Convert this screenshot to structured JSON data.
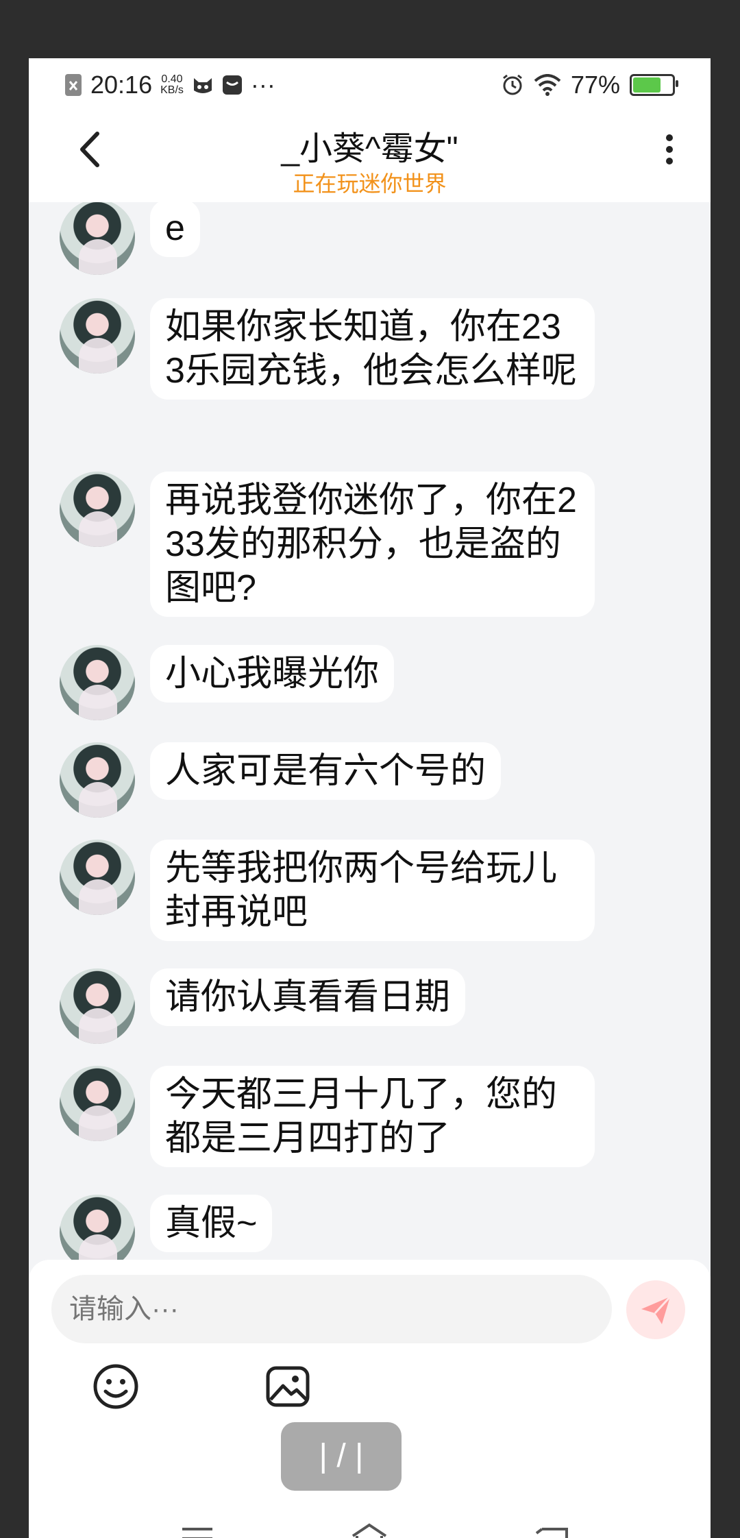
{
  "status_bar": {
    "time": "20:16",
    "net_speed_value": "0.40",
    "net_speed_unit": "KB/s",
    "more": "···",
    "battery_percent": "77%",
    "battery_level": 0.77
  },
  "header": {
    "title": "_小葵^霉女\"",
    "subtitle": "正在玩迷你世界"
  },
  "messages": [
    {
      "text": "e"
    },
    {
      "text": "如果你家长知道，你在233乐园充钱，他会怎么样呢"
    },
    {
      "text": "再说我登你迷你了，你在233发的那积分，也是盗的图吧?"
    },
    {
      "text": "小心我曝光你"
    },
    {
      "text": "人家可是有六个号的"
    },
    {
      "text": "先等我把你两个号给玩儿封再说吧"
    },
    {
      "text": "请你认真看看日期"
    },
    {
      "text": "今天都三月十几了，您的都是三月四打的了"
    },
    {
      "text": "真假~"
    }
  ],
  "input": {
    "placeholder": "请输入···"
  },
  "page_indicator": "| / |",
  "colors": {
    "accent_orange": "#f2921b",
    "send_button_bg": "#ffe7e7",
    "send_icon": "#ff9c9c",
    "chat_bg": "#f3f4f6"
  }
}
